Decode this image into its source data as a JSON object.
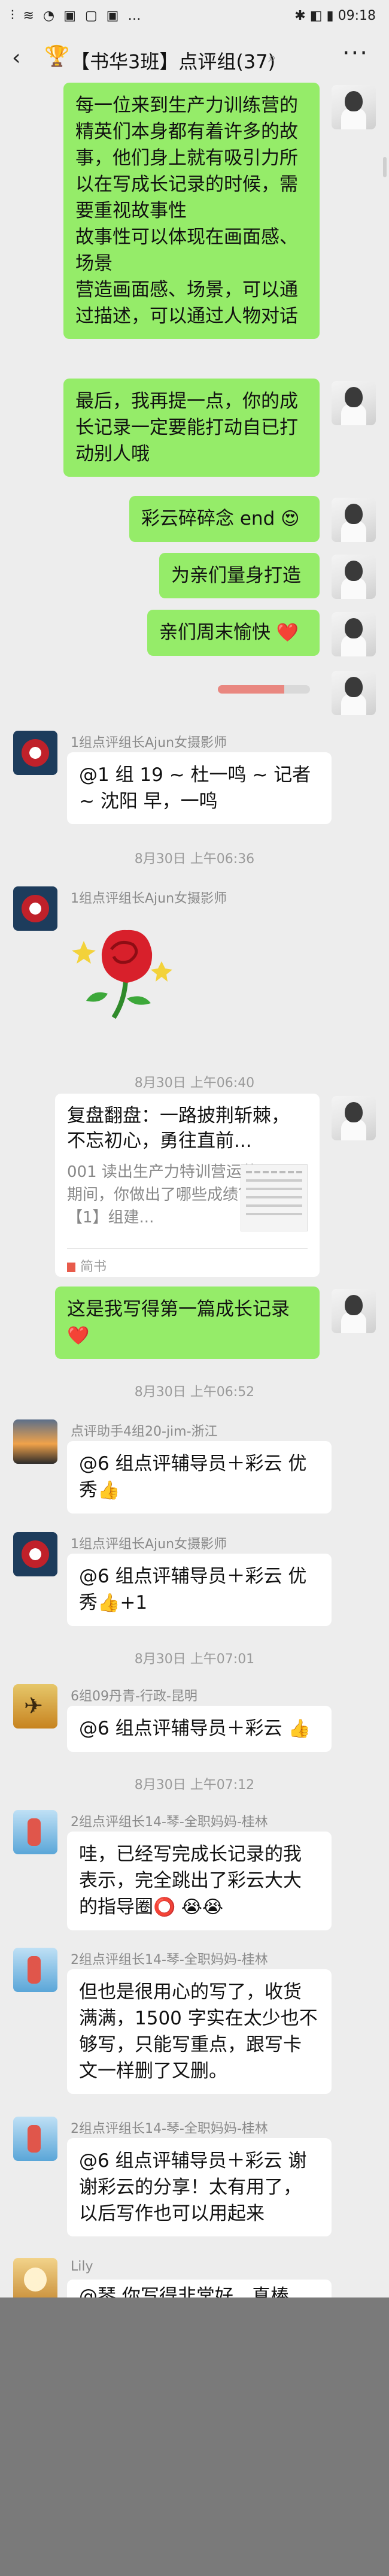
{
  "status_bar": {
    "left_icons": "⫶ ≋ ◔ ▣ ▢ ▣ …",
    "right_text": "✱ ◧ ▮ 09:18"
  },
  "nav": {
    "title": "【书华3班】点评组(37)",
    "muted": "⌕",
    "more": "···"
  },
  "messages": {
    "m1": "每一位来到生产力训练营的精英们本身都有着许多的故事，他们身上就有吸引力所以在写成长记录的时候，需要重视故事性\n故事性可以体现在画面感、场景\n营造画面感、场景，可以通过描述，可以通过人物对话",
    "m2": "最后，我再提一点，你的成长记录一定要能打动自已打动别人哦",
    "m3": "彩云碎碎念 end",
    "m3_emoji": "😍",
    "m4": "为亲们量身打造",
    "m5": "亲们周末愉快",
    "m5_emoji": "❤️",
    "progress": 0.72,
    "sender1": "1组点评组长Ajun女摄影师",
    "m6": "@1 组 19 ~ 杜一鸣 ~ 记者 ~ 沈阳 早，一鸣",
    "ts1": "8月30日 上午06:36",
    "sender2": "1组点评组长Ajun女摄影师",
    "ts2": "8月30日 上午06:40",
    "card_title": "复盘翻盘：一路披荆斩棘，不忘初心，勇往直前...",
    "card_desc": "001 读出生产力特训营运营期间，你做出了哪些成绩？ 【1】组建...",
    "card_source": "简书",
    "m8": "这是我写得第一篇成长记录",
    "m8_emoji": "❤️",
    "ts3": "8月30日 上午06:52",
    "sender3": "点评助手4组20-jim-浙江",
    "m9": "@6 组点评辅导员＋彩云 优秀",
    "m9_emoji": "👍",
    "sender4": "1组点评组长Ajun女摄影师",
    "m10": "@6 组点评辅导员＋彩云 优秀",
    "m10_emoji": "👍",
    "m10_suffix": "+1",
    "ts4": "8月30日 上午07:01",
    "sender5": "6组09丹青-行政-昆明",
    "m11": "@6 组点评辅导员＋彩云",
    "m11_emoji": "👍",
    "ts5": "8月30日 上午07:12",
    "sender6": "2组点评组长14-琴-全职妈妈-桂林",
    "m12": "哇，已经写完成长记录的我表示，完全跳出了彩云大大的指导圈",
    "m12_emoji": "⭕ 😭😭",
    "sender7": "2组点评组长14-琴-全职妈妈-桂林",
    "m13": "但也是很用心的写了，收货满满，1500 字实在太少也不够写，只能写重点，跟写卡文一样删了又删。",
    "sender8": "2组点评组长14-琴-全职妈妈-桂林",
    "m14": "@6 组点评辅导员＋彩云 谢谢彩云的分享！太有用了，以后写作也可以用起来",
    "sender9": "Lily",
    "m15": "@琴 你写得非常好，真棒"
  }
}
